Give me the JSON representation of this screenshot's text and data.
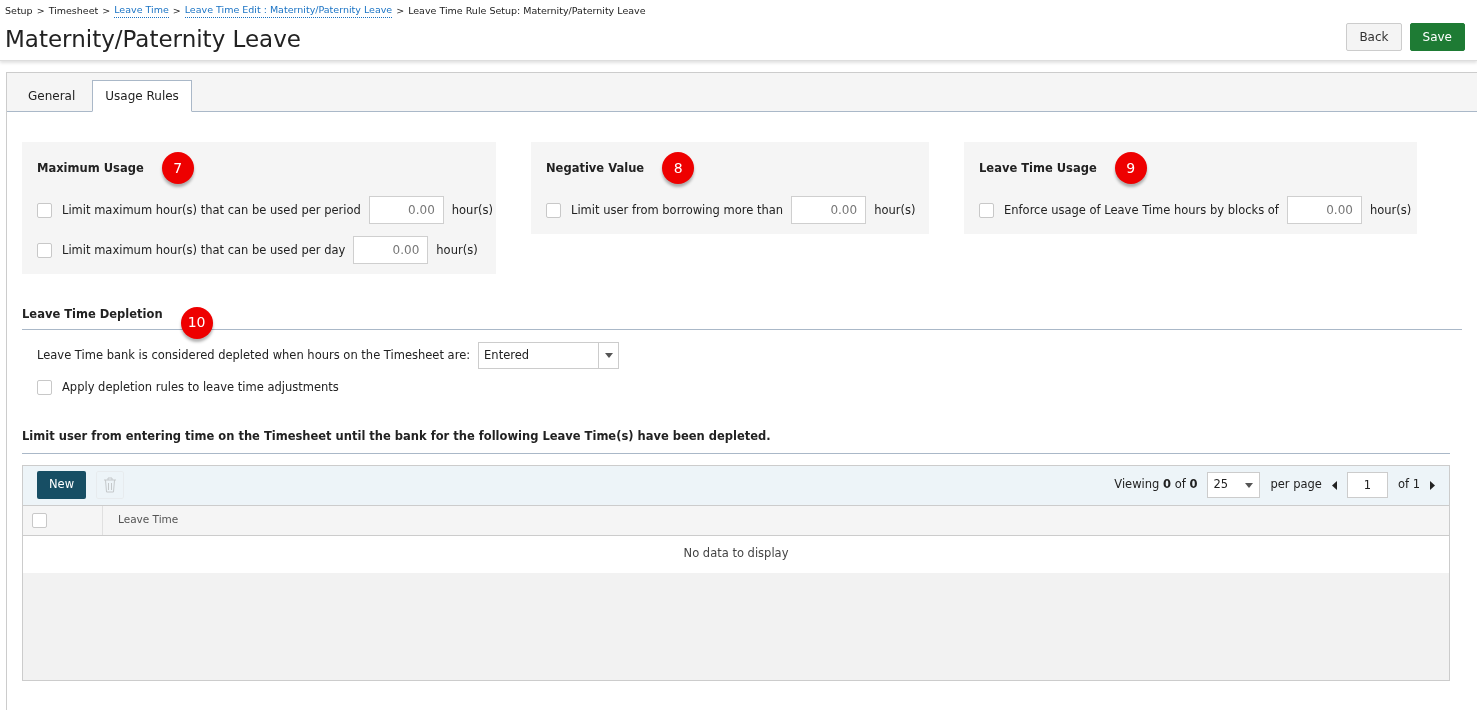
{
  "breadcrumb": [
    {
      "text": "Setup",
      "link": false
    },
    {
      "text": "Timesheet",
      "link": false
    },
    {
      "text": "Leave Time",
      "link": true
    },
    {
      "text": "Leave Time Edit : Maternity/Paternity Leave",
      "link": true
    },
    {
      "text": "Leave Time Rule Setup: Maternity/Paternity Leave",
      "link": false
    }
  ],
  "breadcrumb_separator": ">",
  "title": "Maternity/Paternity Leave",
  "header_buttons": [
    {
      "label": "Back",
      "kind": "secondary"
    },
    {
      "label": "Save",
      "kind": "primary"
    }
  ],
  "tabs": [
    {
      "label": "General",
      "selected": false
    },
    {
      "label": "Usage Rules",
      "selected": true
    }
  ],
  "rule_boxes": [
    {
      "title": "Maximum Usage",
      "marker": "7",
      "rows": [
        {
          "label": "Limit maximum hour(s) that can be used per period",
          "checked": false,
          "value": "0.00",
          "unit": "hour(s)"
        },
        {
          "label": "Limit maximum hour(s) that can be used per day",
          "checked": false,
          "value": "0.00",
          "unit": "hour(s)"
        }
      ]
    },
    {
      "title": "Negative Value",
      "marker": "8",
      "rows": [
        {
          "label": "Limit user from borrowing more than",
          "checked": false,
          "value": "0.00",
          "unit": "hour(s)"
        }
      ]
    },
    {
      "title": "Leave Time Usage",
      "marker": "9",
      "rows": [
        {
          "label": "Enforce usage of Leave Time hours by blocks of",
          "checked": false,
          "value": "0.00",
          "unit": "hour(s)"
        }
      ]
    }
  ],
  "depletion": {
    "title": "Leave Time Depletion",
    "marker": "10",
    "select_label": "Leave Time bank is considered depleted when hours on the Timesheet are:",
    "select_value": "Entered",
    "option": {
      "label": "Apply depletion rules to leave time adjustments",
      "checked": false
    }
  },
  "limit_section": {
    "title": "Limit user from entering time on the Timesheet until the bank for the following Leave Time(s) have been depleted.",
    "grid": {
      "new_button": "New",
      "delete_disabled": true,
      "viewing": "Viewing **0** of **0**",
      "page_size": "25",
      "per_page": "per page",
      "page": "1",
      "of_pages": "of 1",
      "select_all_checked": false,
      "columns": [
        "Leave Time"
      ],
      "empty_message": "No data to display"
    }
  }
}
